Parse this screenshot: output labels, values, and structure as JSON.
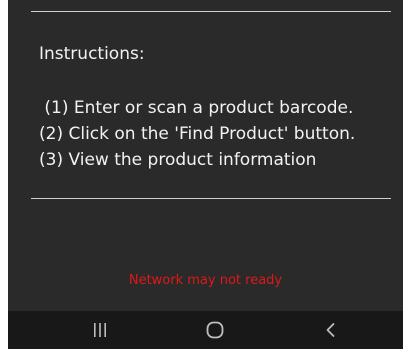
{
  "instructions": {
    "heading": "Instructions:",
    "steps": [
      " (1) Enter or scan a product barcode.",
      "(2) Click on the 'Find Product' button.",
      "(3) View the product information"
    ]
  },
  "status": {
    "message": "Network may not ready",
    "color": "#e01818"
  },
  "navbar": {
    "buttons": [
      {
        "name": "recents",
        "icon": "recent-apps-icon"
      },
      {
        "name": "home",
        "icon": "home-icon"
      },
      {
        "name": "back",
        "icon": "back-icon"
      }
    ]
  },
  "colors": {
    "background": "#2a2a2a",
    "text": "#f2f2f2",
    "navbar": "#181818"
  }
}
